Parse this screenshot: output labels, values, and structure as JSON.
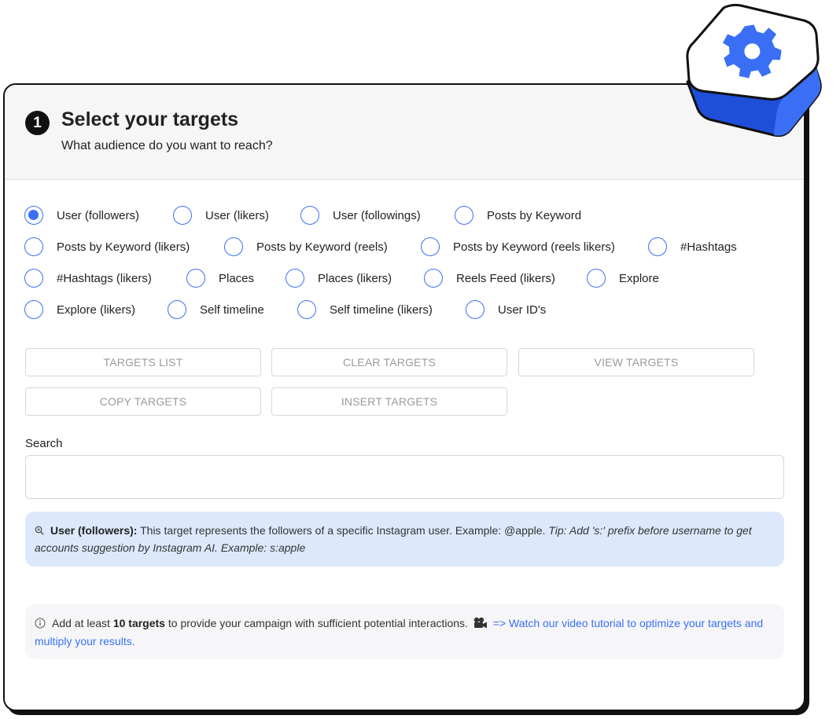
{
  "header": {
    "step_number": "1",
    "title": "Select your targets",
    "subtitle": "What audience do you want to reach?"
  },
  "target_types": [
    {
      "label": "User (followers)",
      "selected": true
    },
    {
      "label": "User (likers)",
      "selected": false
    },
    {
      "label": "User (followings)",
      "selected": false
    },
    {
      "label": "Posts by Keyword",
      "selected": false
    },
    {
      "label": "Posts by Keyword (likers)",
      "selected": false
    },
    {
      "label": "Posts by Keyword (reels)",
      "selected": false
    },
    {
      "label": "Posts by Keyword (reels likers)",
      "selected": false
    },
    {
      "label": "#Hashtags",
      "selected": false
    },
    {
      "label": "#Hashtags (likers)",
      "selected": false
    },
    {
      "label": "Places",
      "selected": false
    },
    {
      "label": "Places (likers)",
      "selected": false
    },
    {
      "label": "Reels Feed (likers)",
      "selected": false
    },
    {
      "label": "Explore",
      "selected": false
    },
    {
      "label": "Explore (likers)",
      "selected": false
    },
    {
      "label": "Self timeline",
      "selected": false
    },
    {
      "label": "Self timeline (likers)",
      "selected": false
    },
    {
      "label": "User ID's",
      "selected": false
    }
  ],
  "buttons": {
    "targets_list": "TARGETS LIST",
    "clear_targets": "CLEAR TARGETS",
    "view_targets": "VIEW TARGETS",
    "copy_targets": "COPY TARGETS",
    "insert_targets": "INSERT TARGETS"
  },
  "search": {
    "label": "Search",
    "value": "",
    "placeholder": ""
  },
  "info": {
    "icon": "magnifier-icon",
    "term": "User (followers):",
    "description": "This target represents the followers of a specific Instagram user. Example: @apple.",
    "tip": "Tip: Add 's:' prefix before username to get accounts suggestion by Instagram AI. Example: s:apple"
  },
  "notice": {
    "icon": "info-circle-icon",
    "text_before": "Add at least",
    "highlight": "10 targets",
    "text_after": "to provide your campaign with sufficient potential interactions.",
    "camera_icon": "movie-camera-icon",
    "link_text": "=> Watch our video tutorial to optimize your targets and multiply your results."
  },
  "colors": {
    "accent": "#3a6ff5",
    "info_bg": "#dde8fc",
    "header_bg": "#f6f6f7",
    "gear_tile": "#3a6ff5"
  }
}
